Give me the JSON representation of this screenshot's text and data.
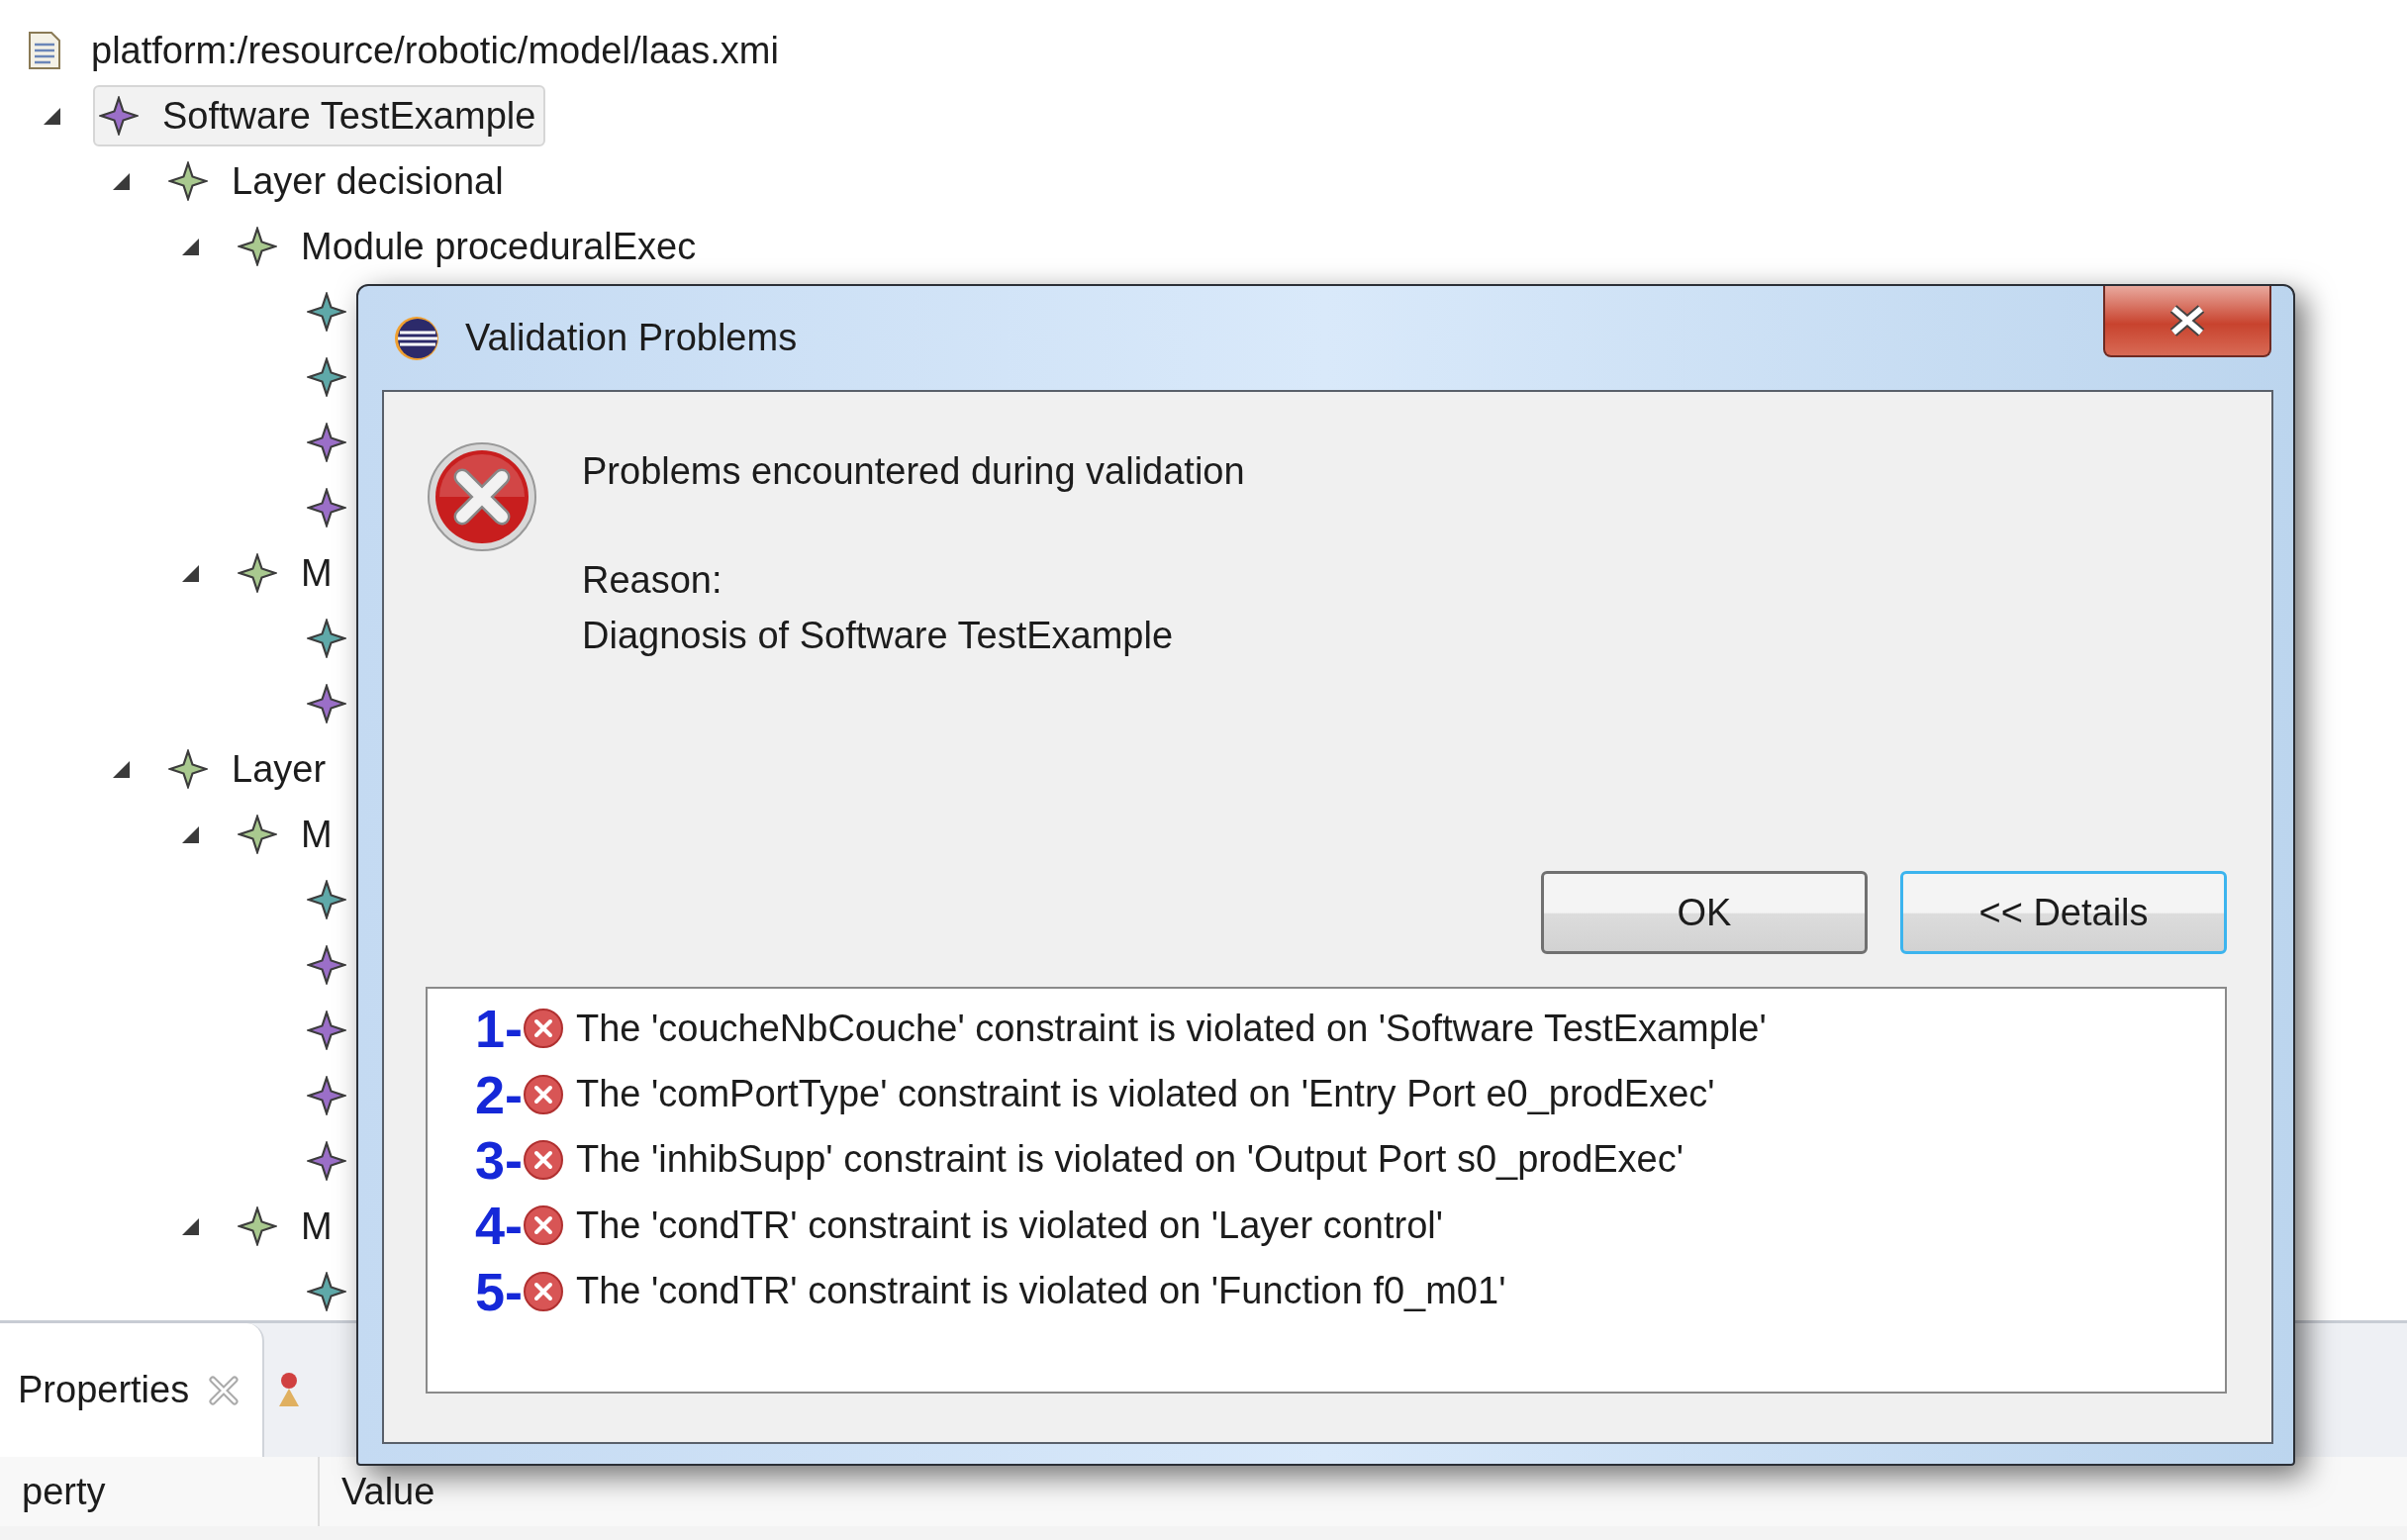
{
  "tree_header": {
    "path": "platform:/resource/robotic/model/laas.xmi"
  },
  "tree": [
    {
      "label": "Software TestExample",
      "color": "#9b6fc8",
      "expanded": true,
      "selected": true,
      "children": [
        {
          "label": "Layer decisional",
          "color": "#a9c98f",
          "expanded": true,
          "selected": false,
          "children": [
            {
              "label": "Module proceduralExec",
              "color": "#a9c98f",
              "expanded": true,
              "selected": false,
              "children": [
                {
                  "color": "#5fa9a9",
                  "selected": false
                },
                {
                  "color": "#5fa9a9",
                  "selected": false
                },
                {
                  "color": "#9b6fc8",
                  "selected": false
                },
                {
                  "color": "#9b6fc8",
                  "selected": false
                }
              ]
            },
            {
              "label": "M",
              "color": "#a9c98f",
              "expanded": true,
              "selected": false,
              "children": [
                {
                  "color": "#5fa9a9",
                  "selected": false
                },
                {
                  "color": "#9b6fc8",
                  "selected": false
                }
              ]
            }
          ]
        },
        {
          "label": "Layer",
          "color": "#a9c98f",
          "expanded": true,
          "selected": false,
          "children": [
            {
              "label": "M",
              "color": "#a9c98f",
              "expanded": true,
              "selected": false,
              "children": [
                {
                  "color": "#5fa9a9",
                  "selected": false
                },
                {
                  "color": "#9b6fc8",
                  "selected": false
                },
                {
                  "color": "#9b6fc8",
                  "selected": false
                },
                {
                  "color": "#9b6fc8",
                  "selected": false
                },
                {
                  "color": "#9b6fc8",
                  "selected": false
                }
              ]
            },
            {
              "label": "M",
              "color": "#a9c98f",
              "expanded": true,
              "selected": false,
              "children": [
                {
                  "color": "#5fa9a9",
                  "selected": false
                }
              ]
            }
          ]
        }
      ]
    }
  ],
  "properties_view": {
    "tab": "Properties",
    "columns": [
      "perty",
      "Value"
    ]
  },
  "dialog": {
    "title": "Validation Problems",
    "message": "Problems encountered during validation",
    "reason_label": "Reason:",
    "reason": "Diagnosis of Software TestExample",
    "buttons": [
      {
        "label": "OK",
        "focused": false
      },
      {
        "label": "<< Details",
        "focused": true
      }
    ],
    "problems": [
      {
        "number": "1-",
        "text": "The 'coucheNbCouche' constraint is violated on 'Software TestExample'"
      },
      {
        "number": "2-",
        "text": "The 'comPortType' constraint is violated on 'Entry Port e0_prodExec'"
      },
      {
        "number": "3-",
        "text": "The 'inhibSupp' constraint is violated on 'Output Port s0_prodExec'"
      },
      {
        "number": "4-",
        "text": "The 'condTR' constraint is violated on 'Layer control'"
      },
      {
        "number": "5-",
        "text": "The 'condTR' constraint is violated on 'Function f0_m01'"
      }
    ]
  }
}
